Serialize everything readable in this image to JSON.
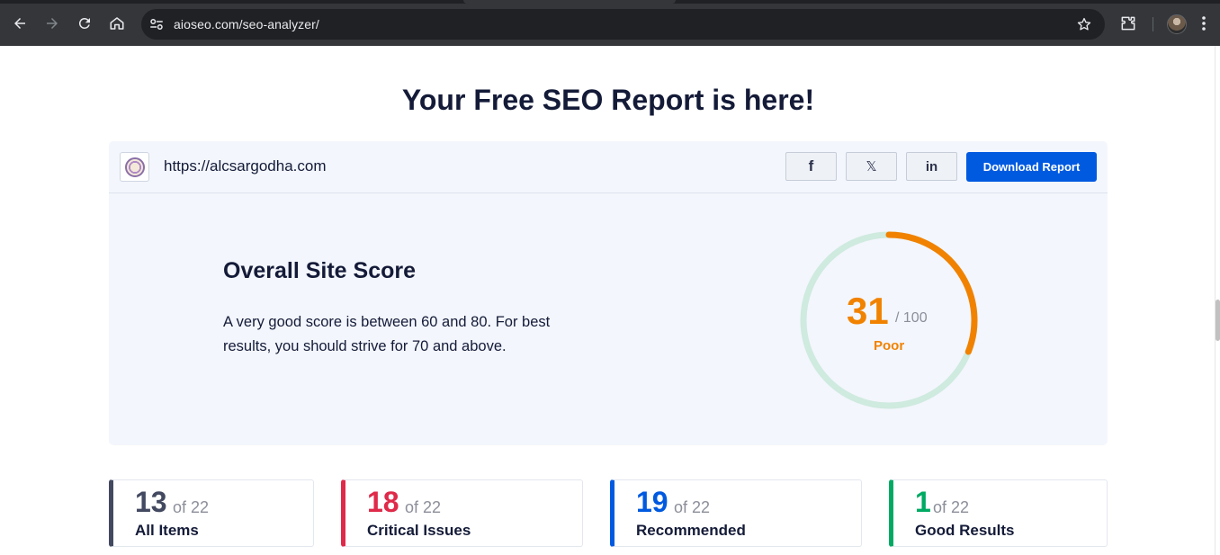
{
  "browser": {
    "url": "aioseo.com/seo-analyzer/"
  },
  "page": {
    "title": "Your Free SEO Report is here!"
  },
  "report": {
    "site_url": "https://alcsargodha.com",
    "share": {
      "facebook_label": "f",
      "x_label": "𝕏",
      "linkedin_label": "in"
    },
    "download_label": "Download Report"
  },
  "score": {
    "heading": "Overall Site Score",
    "description": "A very good score is between 60 and 80. For best results, you should strive for 70 and above.",
    "value": "31",
    "total": "/ 100",
    "rating": "Poor",
    "fraction": 0.31,
    "accent_color": "#f18200",
    "track_color": "#cfeadf"
  },
  "stats": [
    {
      "count": "13",
      "of": "of 22",
      "label": "All Items",
      "color": "#434960"
    },
    {
      "count": "18",
      "of": "of 22",
      "label": "Critical Issues",
      "color": "#df2a4a"
    },
    {
      "count": "19",
      "of": "of 22",
      "label": "Recommended",
      "color": "#005ae0"
    },
    {
      "count": "1",
      "of": "of 22",
      "label": "Good Results",
      "color": "#00aa63"
    }
  ]
}
